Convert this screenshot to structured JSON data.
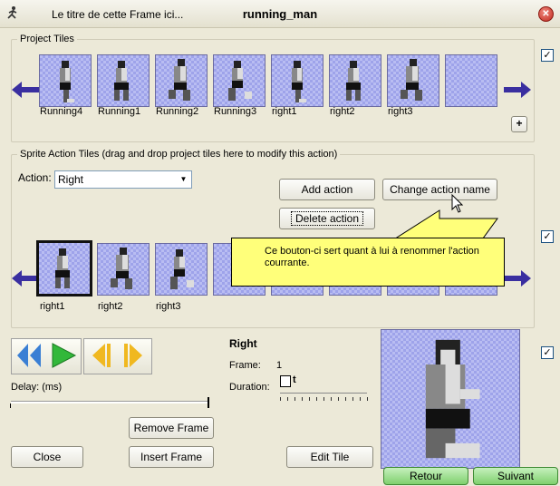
{
  "window": {
    "subtitle": "Le titre de cette Frame ici...",
    "title": "running_man"
  },
  "project_tiles": {
    "legend": "Project Tiles",
    "tiles": [
      "Running4",
      "Running1",
      "Running2",
      "Running3",
      "right1",
      "right2",
      "right3",
      ""
    ]
  },
  "sprite_action": {
    "legend": "Sprite Action Tiles (drag and drop project tiles here to modify this action)",
    "action_label": "Action:",
    "action_value": "Right",
    "add_action": "Add action",
    "change_action": "Change action name",
    "delete_action": "Delete action",
    "tooltip": "Ce bouton-ci sert quant à lui à renommer l'action courrante.",
    "tiles": [
      "right1",
      "right2",
      "right3"
    ]
  },
  "playback": {
    "delay_label": "Delay: (ms)",
    "remove_frame": "Remove Frame",
    "close": "Close",
    "insert_frame": "Insert Frame",
    "edit_tile": "Edit Tile"
  },
  "frame_info": {
    "name": "Right",
    "frame_label": "Frame:",
    "frame_value": "1",
    "duration_label": "Duration:"
  },
  "wizard": {
    "back": "Retour",
    "next": "Suivant"
  },
  "plus": "+",
  "check": "✓",
  "colors": {
    "tile": "#b9bdf2",
    "arrow": "#3a2fa0",
    "tooltip": "#ffff7a",
    "wizard_btn": "#9be08f"
  }
}
